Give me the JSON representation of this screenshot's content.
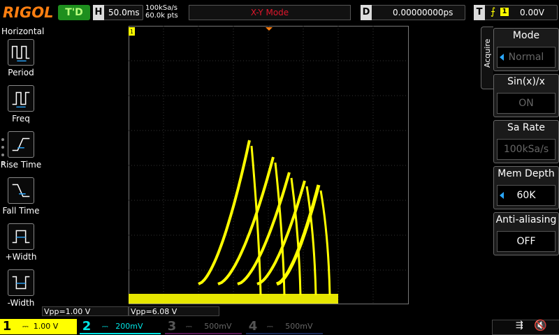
{
  "topbar": {
    "logo": "RIGOL",
    "run_state": "T'D",
    "horizontal_letter": "H",
    "timebase": "50.0ms",
    "sample_rate": "100kSa/s",
    "points": "60.0k pts",
    "mode": "X-Y Mode",
    "delay_letter": "D",
    "delay": "0.00000000ps",
    "trigger_letter": "T",
    "trigger_source": "1",
    "trigger_level": "0.00V"
  },
  "left_panel": {
    "title": "Horizontal",
    "items": [
      {
        "label": "Period",
        "icon": "period-icon"
      },
      {
        "label": "Freq",
        "icon": "freq-icon"
      },
      {
        "label": "Rise Time",
        "icon": "rise-time-icon"
      },
      {
        "label": "Fall Time",
        "icon": "fall-time-icon"
      },
      {
        "label": "+Width",
        "icon": "positive-width-icon"
      },
      {
        "label": "-Width",
        "icon": "negative-width-icon"
      }
    ]
  },
  "measurements": {
    "vpp1": "Vpp=1.00 V",
    "vpp2": "Vpp=6.08 V"
  },
  "channels": [
    {
      "num": "1",
      "scale": "1.00 V",
      "color": "#ffff00",
      "active": true
    },
    {
      "num": "2",
      "scale": "200mV",
      "color": "#00e5e5",
      "active": true
    },
    {
      "num": "3",
      "scale": "500mV",
      "color": "#d020d0",
      "active": false
    },
    {
      "num": "4",
      "scale": "500mV",
      "color": "#2060ff",
      "active": false
    }
  ],
  "right_menu": {
    "tab": "Acquire",
    "items": [
      {
        "title": "Mode",
        "value": "Normal",
        "enabled": false,
        "arrow": true
      },
      {
        "title": "Sin(x)/x",
        "value": "ON",
        "enabled": false,
        "arrow": false
      },
      {
        "title": "Sa Rate",
        "value": "100kSa/s",
        "enabled": false,
        "arrow": false
      },
      {
        "title": "Mem Depth",
        "value": "60K",
        "enabled": true,
        "arrow": true
      },
      {
        "title": "Anti-aliasing",
        "value": "OFF",
        "enabled": true,
        "arrow": false
      }
    ]
  },
  "colors": {
    "ch1": "#ffff00",
    "accent": "#ff7f11",
    "mode_text": "#e0162b"
  }
}
